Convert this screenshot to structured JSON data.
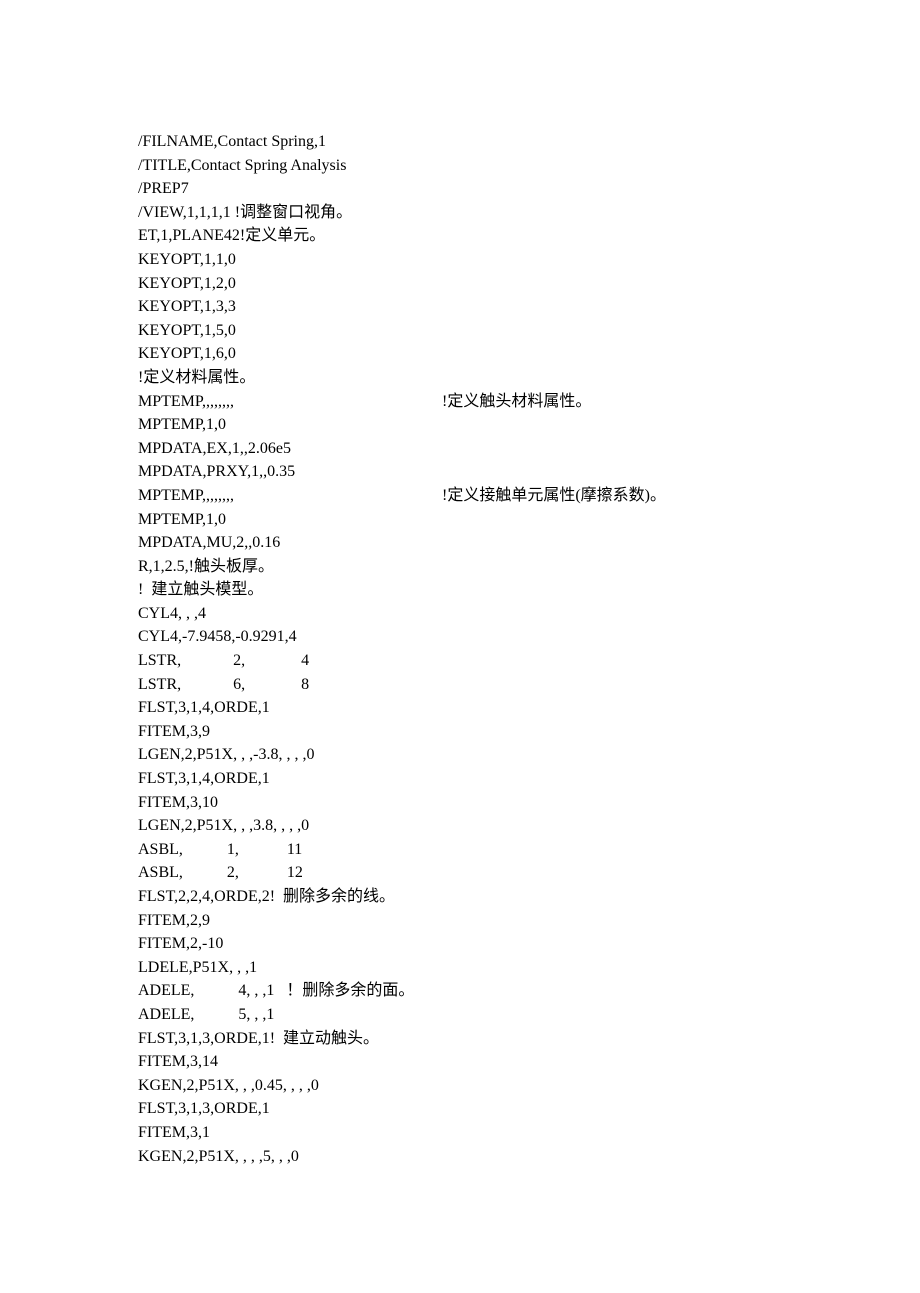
{
  "lines": [
    "/FILNAME,Contact Spring,1",
    "/TITLE,Contact Spring Analysis",
    "/PREP7",
    "/VIEW,1,1,1,1 !调整窗口视角。",
    "ET,1,PLANE42!定义单元。",
    "KEYOPT,1,1,0",
    "KEYOPT,1,2,0",
    "KEYOPT,1,3,3",
    "KEYOPT,1,5,0",
    "KEYOPT,1,6,0",
    "!定义材料属性。",
    "MPTEMP,,,,,,,,                                                    !定义触头材料属性。",
    "MPTEMP,1,0",
    "MPDATA,EX,1,,2.06e5",
    "MPDATA,PRXY,1,,0.35",
    "MPTEMP,,,,,,,,                                                    !定义接触单元属性(摩擦系数)。",
    "MPTEMP,1,0",
    "MPDATA,MU,2,,0.16",
    "R,1,2.5,!触头板厚。",
    "!  建立触头模型。",
    "CYL4, , ,4",
    "CYL4,-7.9458,-0.9291,4",
    "LSTR,             2,              4",
    "LSTR,             6,              8",
    "FLST,3,1,4,ORDE,1",
    "FITEM,3,9",
    "LGEN,2,P51X, , ,-3.8, , , ,0",
    "FLST,3,1,4,ORDE,1",
    "FITEM,3,10",
    "LGEN,2,P51X, , ,3.8, , , ,0",
    "ASBL,           1,            11",
    "ASBL,           2,            12",
    "FLST,2,2,4,ORDE,2!  删除多余的线。",
    "FITEM,2,9",
    "FITEM,2,-10",
    "LDELE,P51X, , ,1",
    "ADELE,           4, , ,1   ！删除多余的面。",
    "ADELE,           5, , ,1",
    "FLST,3,1,3,ORDE,1!  建立动触头。",
    "FITEM,3,14",
    "KGEN,2,P51X, , ,0.45, , , ,0",
    "FLST,3,1,3,ORDE,1",
    "FITEM,3,1",
    "KGEN,2,P51X, , , ,5, , ,0"
  ]
}
